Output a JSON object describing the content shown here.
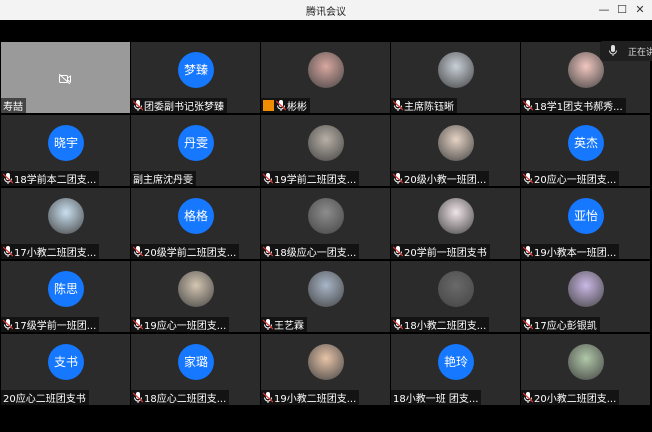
{
  "window": {
    "title": "腾讯会议"
  },
  "speaking": {
    "label": "正在讲"
  },
  "colors": {
    "avatar_blue": "#1677ff",
    "tile_bg": "#2b2b2b",
    "video_bg": "#9a9a9a",
    "mic_red": "#e03535",
    "share_orange": "#f08c00"
  },
  "tiles": [
    {
      "name": "寿喆",
      "type": "video",
      "mic": false
    },
    {
      "name": "团委副书记张梦臻",
      "type": "text",
      "avatar": "梦臻",
      "mic": true
    },
    {
      "name": "彬彬",
      "type": "photo",
      "mic": true,
      "share": true
    },
    {
      "name": "主席陈钰晰",
      "type": "photo",
      "mic": true
    },
    {
      "name": "18学1团支书郝秀...",
      "type": "photo",
      "mic": true
    },
    {
      "name": "18学前本二团支...",
      "type": "text",
      "avatar": "晓宇",
      "mic": true
    },
    {
      "name": "副主席沈丹雯",
      "type": "text",
      "avatar": "丹雯",
      "mic": false
    },
    {
      "name": "19学前二班团支...",
      "type": "photo",
      "mic": true
    },
    {
      "name": "20级小教一班团...",
      "type": "photo",
      "mic": true
    },
    {
      "name": "20应心一班团支...",
      "type": "text",
      "avatar": "英杰",
      "mic": true
    },
    {
      "name": "17小教二班团支...",
      "type": "photo",
      "mic": true
    },
    {
      "name": "20级学前二班团支...",
      "type": "text",
      "avatar": "格格",
      "mic": true
    },
    {
      "name": "18级应心一团支...",
      "type": "photo",
      "mic": true
    },
    {
      "name": "20学前一班团支书",
      "type": "photo",
      "mic": true
    },
    {
      "name": "19小教本一班团...",
      "type": "text",
      "avatar": "亚怡",
      "mic": true
    },
    {
      "name": "17级学前一班团...",
      "type": "text",
      "avatar": "陈思",
      "mic": true
    },
    {
      "name": "19应心一班团支...",
      "type": "photo",
      "mic": true
    },
    {
      "name": "王艺霖",
      "type": "photo",
      "mic": true
    },
    {
      "name": "18小教二班团支...",
      "type": "photo",
      "mic": true
    },
    {
      "name": "17应心彭银凯",
      "type": "photo",
      "mic": true
    },
    {
      "name": "20应心二班团支书",
      "type": "text",
      "avatar": "支书",
      "mic": false
    },
    {
      "name": "18应心二班团支...",
      "type": "text",
      "avatar": "家璐",
      "mic": true
    },
    {
      "name": "19小教二班团支...",
      "type": "photo",
      "mic": true
    },
    {
      "name": "18小教一班 团支...",
      "type": "text",
      "avatar": "艳玲",
      "mic": false
    },
    {
      "name": "20小教二班团支...",
      "type": "photo",
      "mic": true
    }
  ]
}
